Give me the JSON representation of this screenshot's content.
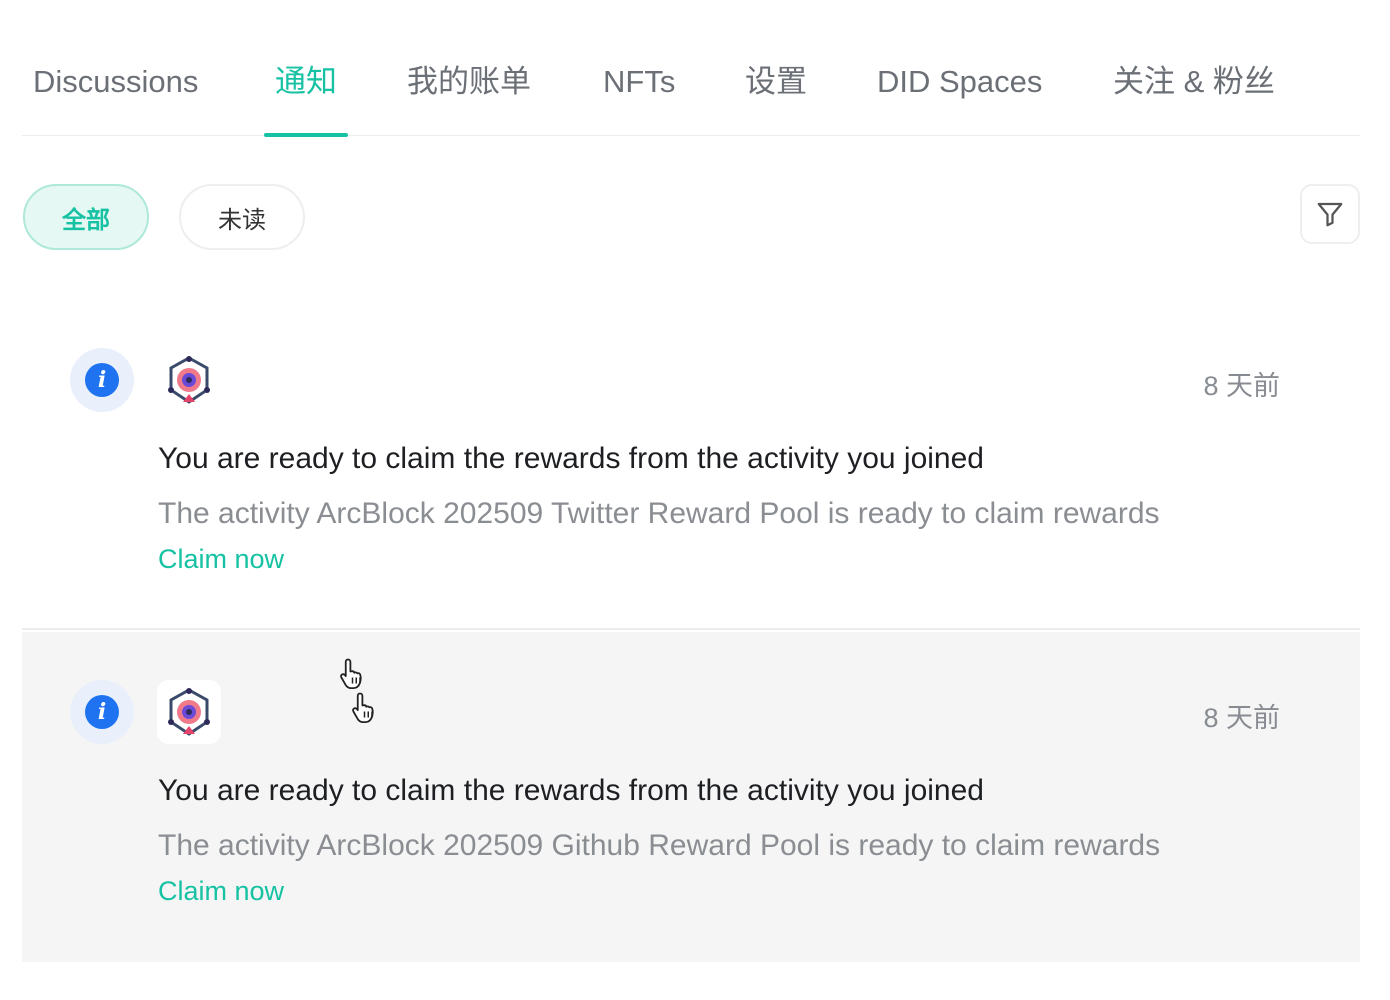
{
  "tabs": [
    {
      "label": "Discussions",
      "active": false
    },
    {
      "label": "通知",
      "active": true
    },
    {
      "label": "我的账单",
      "active": false
    },
    {
      "label": "NFTs",
      "active": false
    },
    {
      "label": "设置",
      "active": false
    },
    {
      "label": "DID Spaces",
      "active": false
    },
    {
      "label": "关注 & 粉丝",
      "active": false
    }
  ],
  "filters": {
    "all_label": "全部",
    "unread_label": "未读",
    "selected": "全部",
    "filter_icon": "funnel-icon"
  },
  "notifications": [
    {
      "icon": "info-icon",
      "app_icon": "arcblock-app-icon",
      "time": "8 天前",
      "title": "You are ready to claim the rewards from the activity you joined",
      "description": "The activity ArcBlock 202509 Twitter Reward Pool is ready to claim rewards",
      "action_label": "Claim now"
    },
    {
      "icon": "info-icon",
      "app_icon": "arcblock-app-icon",
      "time": "8 天前",
      "title": "You are ready to claim the rewards from the activity you joined",
      "description": "The activity ArcBlock 202509 Github Reward Pool is ready to claim rewards",
      "action_label": "Claim now"
    }
  ],
  "colors": {
    "accent": "#16c2a3",
    "info": "#1f73f0",
    "hover_row": "#f5f5f5"
  }
}
